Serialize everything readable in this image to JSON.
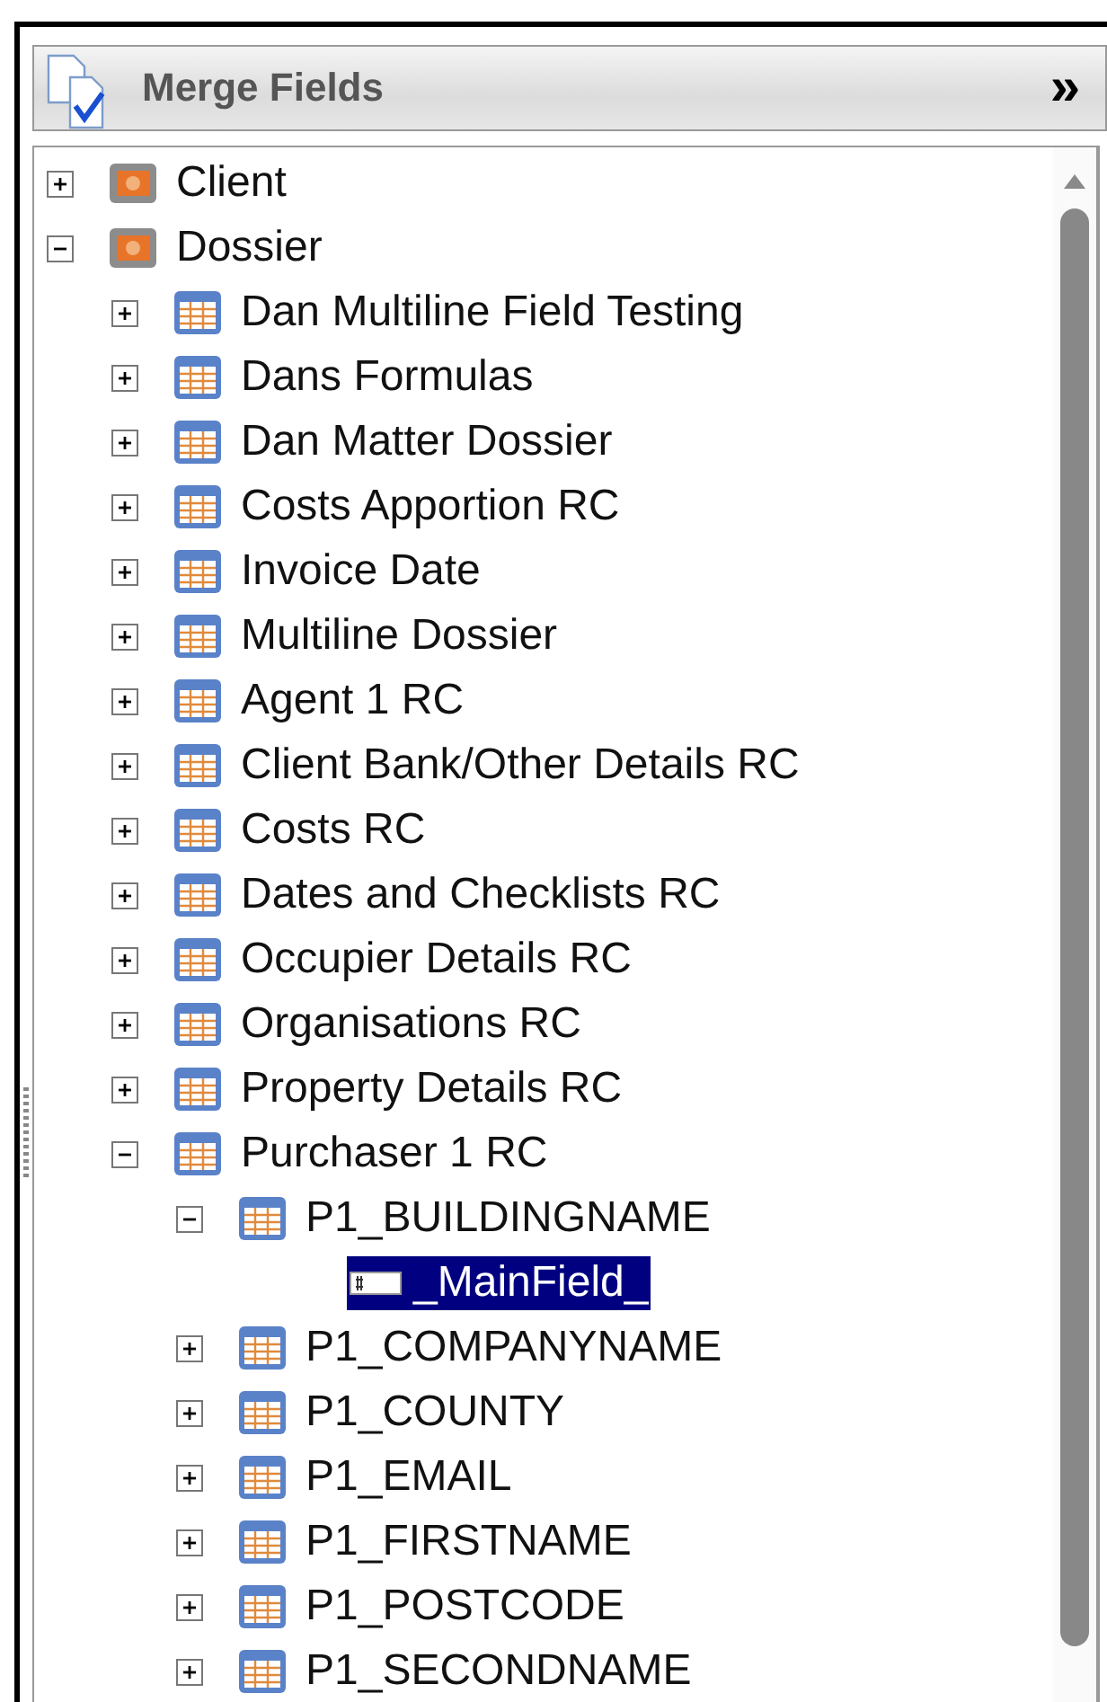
{
  "panel": {
    "title": "Merge Fields",
    "collapse_glyph": "»"
  },
  "tree": [
    {
      "label": "Client",
      "kind": "folder",
      "expanded": false,
      "selected": false
    },
    {
      "label": "Dossier",
      "kind": "folder",
      "expanded": true,
      "selected": false,
      "children": [
        {
          "label": "Dan Multiline Field Testing",
          "kind": "table",
          "expanded": false,
          "selected": false
        },
        {
          "label": "Dans Formulas",
          "kind": "table",
          "expanded": false,
          "selected": false
        },
        {
          "label": "Dan Matter Dossier",
          "kind": "table",
          "expanded": false,
          "selected": false
        },
        {
          "label": "Costs Apportion RC",
          "kind": "table",
          "expanded": false,
          "selected": false
        },
        {
          "label": "Invoice Date",
          "kind": "table",
          "expanded": false,
          "selected": false
        },
        {
          "label": "Multiline Dossier",
          "kind": "table",
          "expanded": false,
          "selected": false
        },
        {
          "label": "Agent 1 RC",
          "kind": "table",
          "expanded": false,
          "selected": false
        },
        {
          "label": "Client Bank/Other Details RC",
          "kind": "table",
          "expanded": false,
          "selected": false
        },
        {
          "label": "Costs RC",
          "kind": "table",
          "expanded": false,
          "selected": false
        },
        {
          "label": "Dates and Checklists RC",
          "kind": "table",
          "expanded": false,
          "selected": false
        },
        {
          "label": "Occupier Details RC",
          "kind": "table",
          "expanded": false,
          "selected": false
        },
        {
          "label": "Organisations RC",
          "kind": "table",
          "expanded": false,
          "selected": false
        },
        {
          "label": "Property Details RC",
          "kind": "table",
          "expanded": false,
          "selected": false
        },
        {
          "label": "Purchaser 1 RC",
          "kind": "table",
          "expanded": true,
          "selected": false,
          "children": [
            {
              "label": "P1_BUILDINGNAME",
              "kind": "table",
              "expanded": true,
              "selected": false,
              "children": [
                {
                  "label": "_MainField_",
                  "kind": "field",
                  "selected": true
                }
              ]
            },
            {
              "label": "P1_COMPANYNAME",
              "kind": "table",
              "expanded": false,
              "selected": false
            },
            {
              "label": "P1_COUNTY",
              "kind": "table",
              "expanded": false,
              "selected": false
            },
            {
              "label": "P1_EMAIL",
              "kind": "table",
              "expanded": false,
              "selected": false
            },
            {
              "label": "P1_FIRSTNAME",
              "kind": "table",
              "expanded": false,
              "selected": false
            },
            {
              "label": "P1_POSTCODE",
              "kind": "table",
              "expanded": false,
              "selected": false
            },
            {
              "label": "P1_SECONDNAME",
              "kind": "table",
              "expanded": false,
              "selected": false
            }
          ]
        }
      ]
    }
  ]
}
